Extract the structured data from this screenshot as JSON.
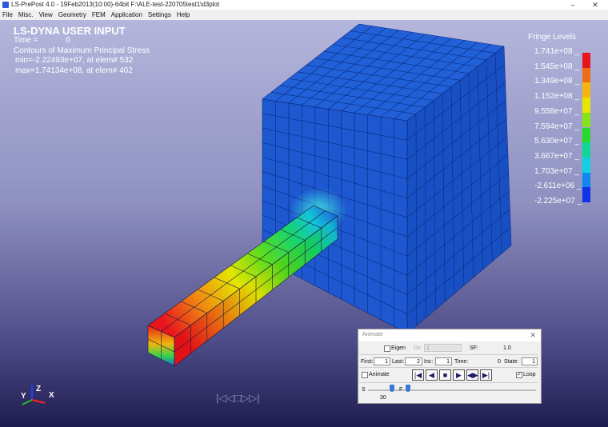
{
  "window": {
    "title": "LS-PrePost 4.0 - 19Feb2013(10:00)-64bit F:\\ALE-test-220705test1\\d3plot",
    "minimize_icon": "minimize-icon",
    "close_icon": "close-icon"
  },
  "menu": [
    "File",
    "Misc.",
    "View",
    "Geometry",
    "FEM",
    "Application",
    "Settings",
    "Help"
  ],
  "viewport": {
    "title": "LS-DYNA USER INPUT",
    "time_label": "Time =",
    "time_value": "0",
    "contours": "Contours of Maximum Principal Stress",
    "min": "min=-2.22493e+07, at elem# 532",
    "max": "max=1.74134e+08, at elem# 402"
  },
  "fringe": {
    "title": "Fringe Levels",
    "levels": [
      "1.741e+08",
      "1.545e+08",
      "1.349e+08",
      "1.152e+08",
      "9.558e+07",
      "7.594e+07",
      "5.630e+07",
      "3.667e+07",
      "1.703e+07",
      "-2.611e+06",
      "-2.225e+07"
    ],
    "colors": [
      "#e8161c",
      "#f06c12",
      "#f4b60c",
      "#e8e600",
      "#88e41a",
      "#28d82a",
      "#10d894",
      "#10d0e4",
      "#1088f0",
      "#1032e8"
    ]
  },
  "triad": {
    "z": "Z",
    "y": "Y",
    "x": "X"
  },
  "playback_faded": "|◁◁□▷▷|",
  "animate": {
    "title": "Animate",
    "eigen_label": "Eigen",
    "dir_label": "Dir:",
    "dir_value": "1",
    "sf_label": "SF:",
    "sf_value": "1.0",
    "first_label": "First:",
    "first_value": "1",
    "last_label": "Last:",
    "last_value": "2",
    "inc_label": "Inc:",
    "inc_value": "1",
    "time_label": "Time:",
    "time_value": "0",
    "state_label": "State:",
    "state_value": "1",
    "animate_label": "Animate",
    "loop_label": "Loop",
    "loop_checked": true,
    "slider_s": "S",
    "slider_f": "F",
    "slider_value": "30"
  }
}
